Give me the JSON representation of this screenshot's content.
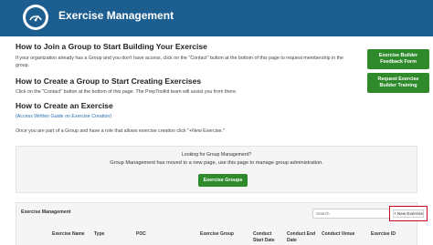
{
  "header": {
    "title": "Exercise Management",
    "logo_icon": "gauge-icon"
  },
  "sections": [
    {
      "heading": "How to Join a Group to Start Building Your Exercise",
      "body": "If your organization already has a Group and you don't have access, click on the \"Contact\" button at the bottom of this page to request membership in the group."
    },
    {
      "heading": "How to Create a Group to Start Creating Exercises",
      "body": "Click on the \"Contact\" button at the bottom of this page. The PrepToolkit team will assist you from there."
    },
    {
      "heading": "How to Create an Exercise",
      "link": "(Access Written Guide on Exercise Creation)",
      "body": "Once you are part of a Group and have a role that allows exercise creation click \"+New Exercise.\""
    }
  ],
  "side_buttons": {
    "feedback_line1": "Exercise Builder",
    "feedback_line2": "Feedback Form",
    "training_line1": "Request Exercise",
    "training_line2": "Builder Training"
  },
  "notice": {
    "question": "Looking for Group Management?",
    "message": "Group Management has moved to a new page, use this page to manage group administration.",
    "button": "Exercise Groups"
  },
  "panel": {
    "title": "Exercise Management",
    "search_placeholder": "Search",
    "new_button": "+ New Exercise"
  },
  "table": {
    "columns": [
      {
        "line1": "Exercise Name",
        "line2": ""
      },
      {
        "line1": "Type",
        "line2": ""
      },
      {
        "line1": "POC",
        "line2": ""
      },
      {
        "line1": "Exercise Group",
        "line2": ""
      },
      {
        "line1": "Conduct",
        "line2": "Start Date"
      },
      {
        "line1": "Conduct End",
        "line2": "Date"
      },
      {
        "line1": "Conduct Venue",
        "line2": ""
      },
      {
        "line1": "Exercise ID",
        "line2": ""
      }
    ]
  },
  "colors": {
    "header_bg": "#1b5e8f",
    "button_green": "#2e8a2b",
    "highlight_red": "#d0021b"
  }
}
